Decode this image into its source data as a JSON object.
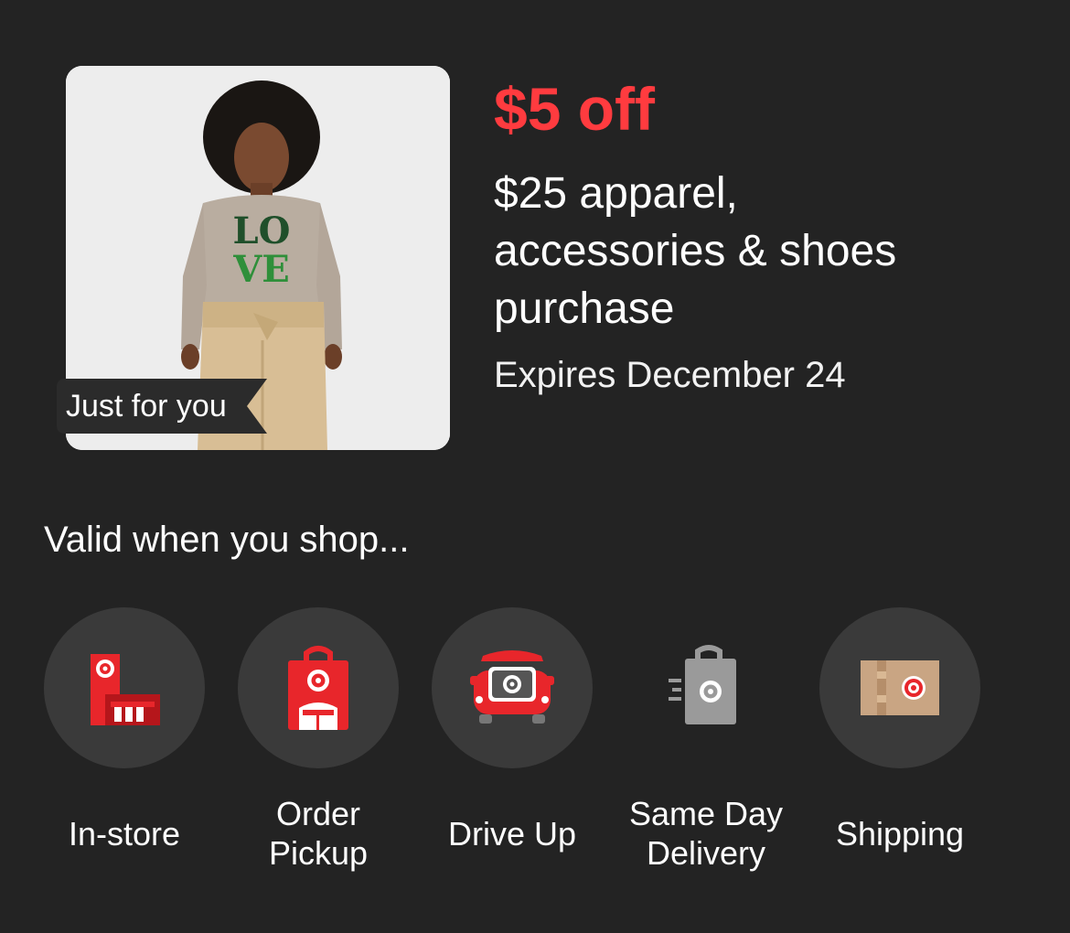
{
  "offer": {
    "badge": "Just for you",
    "discount": "$5 off",
    "description_lines": [
      "$25 apparel,",
      "accessories & shoes",
      "purchase"
    ],
    "expires": "Expires December 24",
    "image": {
      "sweater_text_top": "LO",
      "sweater_text_bottom": "VE"
    }
  },
  "valid": {
    "heading": "Valid when you shop...",
    "methods": [
      {
        "icon": "store-icon",
        "label": "In-store"
      },
      {
        "icon": "order-pickup-bag-icon",
        "label": "Order Pickup"
      },
      {
        "icon": "drive-up-car-icon",
        "label": "Drive Up"
      },
      {
        "icon": "same-day-delivery-bag-icon",
        "label": "Same Day Delivery"
      },
      {
        "icon": "shipping-box-icon",
        "label": "Shipping"
      }
    ]
  },
  "colors": {
    "background": "#232323",
    "accent_red": "#ff3b3f",
    "icon_red": "#e8262b",
    "circle": "#3a3a3a"
  }
}
